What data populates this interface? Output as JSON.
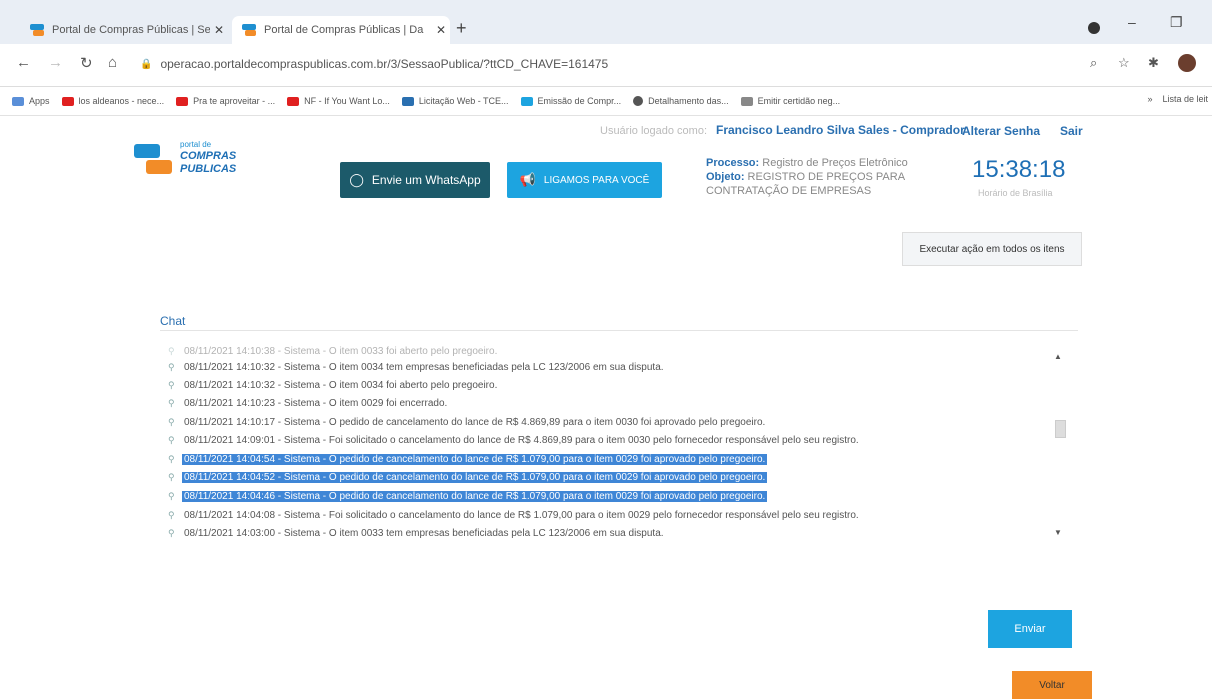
{
  "browser": {
    "tabs": [
      {
        "title": "Portal de Compras Públicas | Se"
      },
      {
        "title": "Portal de Compras Públicas | Da"
      }
    ],
    "url": "operacao.portaldecompraspublicas.com.br/3/SessaoPublica/?ttCD_CHAVE=161475",
    "bookmarks": [
      {
        "label": "Apps",
        "color": "#5a8fd8"
      },
      {
        "label": "los aldeanos - nece...",
        "color": "#e02020"
      },
      {
        "label": "Pra te aproveitar - ...",
        "color": "#e02020"
      },
      {
        "label": "NF - If You Want Lo...",
        "color": "#e02020"
      },
      {
        "label": "Licitação Web - TCE...",
        "color": "#2a6fb0"
      },
      {
        "label": "Emissão de Compr...",
        "color": "#1da4e0"
      },
      {
        "label": "Detalhamento das...",
        "color": "#555555"
      },
      {
        "label": "Emitir certidão neg...",
        "color": "#888888"
      }
    ],
    "bookmarks_overflow": "»",
    "reading_list": "Lista de leit"
  },
  "header": {
    "logged_label": "Usuário logado como:",
    "buyer": "Francisco Leandro Silva Sales - Comprador",
    "change_password": "Alterar Senha",
    "logout": "Sair",
    "logo_small": "portal de",
    "logo_line1": "COMPRAS",
    "logo_line2": "PUBLICAS",
    "whatsapp": "Envie um WhatsApp",
    "call": "LIGAMOS PARA VOCÊ",
    "process_label": "Processo:",
    "process_value": " Registro de Preços Eletrônico",
    "object_label": "Objeto:",
    "object_value": " REGISTRO DE PREÇOS PARA CONTRATAÇÃO DE EMPRESAS",
    "clock": "15:38:18",
    "clock_sub": "Horário de Brasília"
  },
  "actions": {
    "exec_all": "Executar ação em todos os itens",
    "send": "Enviar",
    "back": "Voltar"
  },
  "chat": {
    "title": "Chat",
    "messages": [
      {
        "text": "08/11/2021 14:10:38 - Sistema - O item 0033 foi aberto pelo pregoeiro.",
        "highlight": false
      },
      {
        "text": "08/11/2021 14:10:32 - Sistema - O item 0034 tem empresas beneficiadas pela LC 123/2006 em sua disputa.",
        "highlight": false
      },
      {
        "text": "08/11/2021 14:10:32 - Sistema - O item 0034 foi aberto pelo pregoeiro.",
        "highlight": false
      },
      {
        "text": "08/11/2021 14:10:23 - Sistema - O item 0029 foi encerrado.",
        "highlight": false
      },
      {
        "text": "08/11/2021 14:10:17 - Sistema - O pedido de cancelamento do lance de R$ 4.869,89 para o item 0030 foi aprovado pelo pregoeiro.",
        "highlight": false
      },
      {
        "text": "08/11/2021 14:09:01 - Sistema - Foi solicitado o cancelamento do lance de R$ 4.869,89 para o item 0030 pelo fornecedor responsável pelo seu registro.",
        "highlight": false
      },
      {
        "text": "08/11/2021 14:04:54 - Sistema - O pedido de cancelamento do lance de R$ 1.079,00 para o item 0029 foi aprovado pelo pregoeiro.",
        "highlight": true
      },
      {
        "text": "08/11/2021 14:04:52 - Sistema - O pedido de cancelamento do lance de R$ 1.079,00 para o item 0029 foi aprovado pelo pregoeiro.",
        "highlight": true
      },
      {
        "text": "08/11/2021 14:04:46 - Sistema - O pedido de cancelamento do lance de R$ 1.079,00 para o item 0029 foi aprovado pelo pregoeiro.",
        "highlight": true
      },
      {
        "text": "08/11/2021 14:04:08 - Sistema - Foi solicitado o cancelamento do lance de R$ 1.079,00 para o item 0029 pelo fornecedor responsável pelo seu registro.",
        "highlight": false
      },
      {
        "text": "08/11/2021 14:03:00 - Sistema - O item 0033 tem empresas beneficiadas pela LC 123/2006 em sua disputa.",
        "highlight": false
      }
    ]
  }
}
